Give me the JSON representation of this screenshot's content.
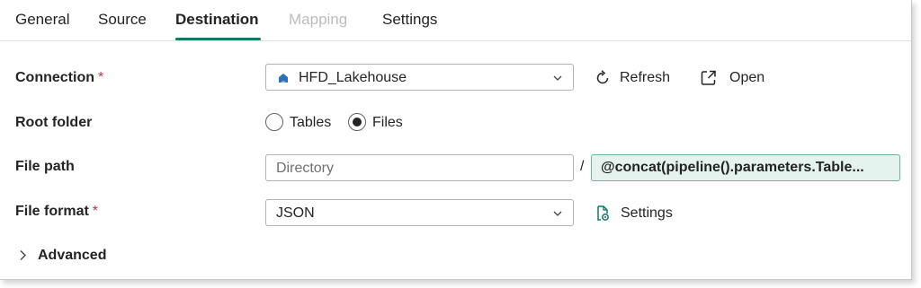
{
  "tabs": {
    "general": "General",
    "source": "Source",
    "destination": "Destination",
    "mapping": "Mapping",
    "settings": "Settings",
    "active": "Destination"
  },
  "connection": {
    "label": "Connection",
    "required_mark": "*",
    "value": "HFD_Lakehouse",
    "icon": "lakehouse-icon",
    "refresh_label": "Refresh",
    "open_label": "Open"
  },
  "root_folder": {
    "label": "Root folder",
    "options": [
      {
        "label": "Tables",
        "selected": false
      },
      {
        "label": "Files",
        "selected": true
      }
    ]
  },
  "file_path": {
    "label": "File path",
    "directory_placeholder": "Directory",
    "separator": "/",
    "file_name_expression": "@concat(pipeline().parameters.Table..."
  },
  "file_format": {
    "label": "File format",
    "required_mark": "*",
    "value": "JSON",
    "settings_label": "Settings"
  },
  "advanced": {
    "label": "Advanced",
    "expanded": false
  },
  "colors": {
    "accent": "#117865",
    "required": "#c4314b",
    "expression_bg": "#e5f3ee",
    "disabled_text": "#bdbdbd"
  }
}
